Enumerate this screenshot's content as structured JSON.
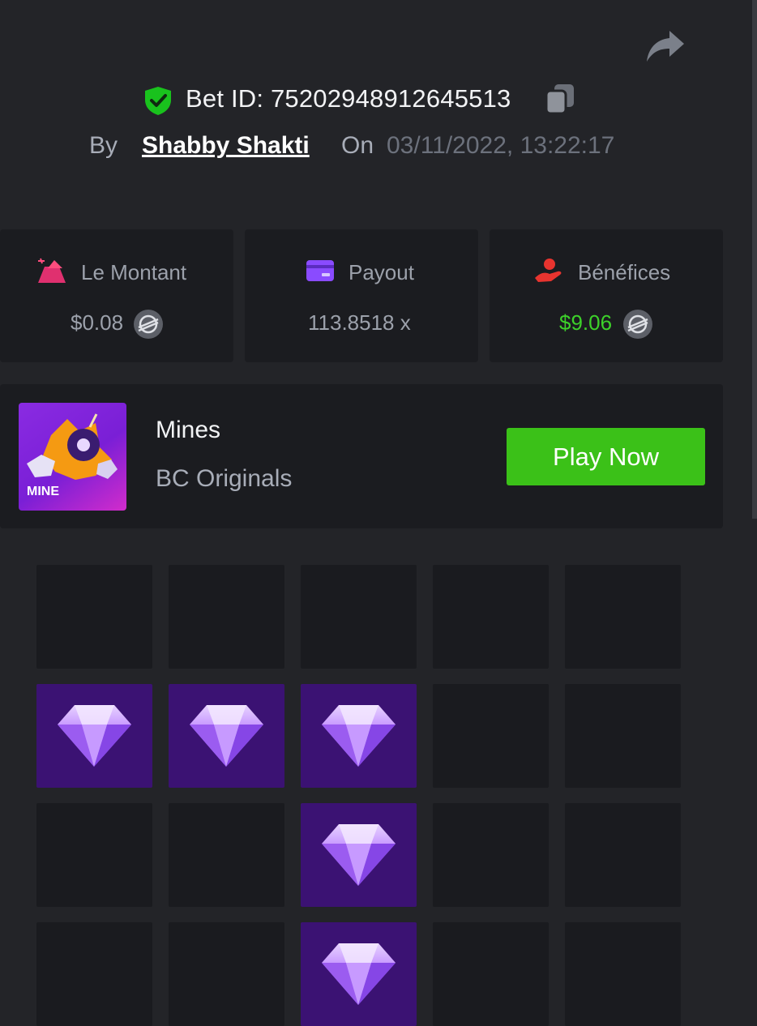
{
  "header": {
    "bet_id": "Bet ID: 75202948912645513",
    "by_label": "By",
    "username": "Shabby Shakti",
    "on_label": "On",
    "datetime": "03/11/2022, 13:22:17"
  },
  "stats": {
    "amount": {
      "label": "Le Montant",
      "value": "$0.08",
      "icon": "bet-amount-icon"
    },
    "payout": {
      "label": "Payout",
      "value": "113.8518 x",
      "icon": "wallet-card-icon"
    },
    "profit": {
      "label": "Bénéfices",
      "value": "$9.06",
      "icon": "hand-coin-icon"
    }
  },
  "game": {
    "name": "Mines",
    "provider": "BC Originals",
    "thumb_text": "MINE",
    "play_label": "Play Now"
  },
  "colors": {
    "background": "#232428",
    "card": "#1b1c20",
    "accent_green": "#3bc118",
    "profit_green": "#3dd12a",
    "gem_tile": "#3b1273",
    "shield_green": "#19c21d"
  },
  "board": {
    "rows": [
      [
        "hidden",
        "hidden",
        "hidden",
        "hidden",
        "hidden"
      ],
      [
        "gem",
        "gem",
        "gem",
        "hidden",
        "hidden"
      ],
      [
        "hidden",
        "hidden",
        "gem",
        "hidden",
        "hidden"
      ],
      [
        "hidden",
        "hidden",
        "gem",
        "hidden",
        "hidden"
      ]
    ]
  }
}
